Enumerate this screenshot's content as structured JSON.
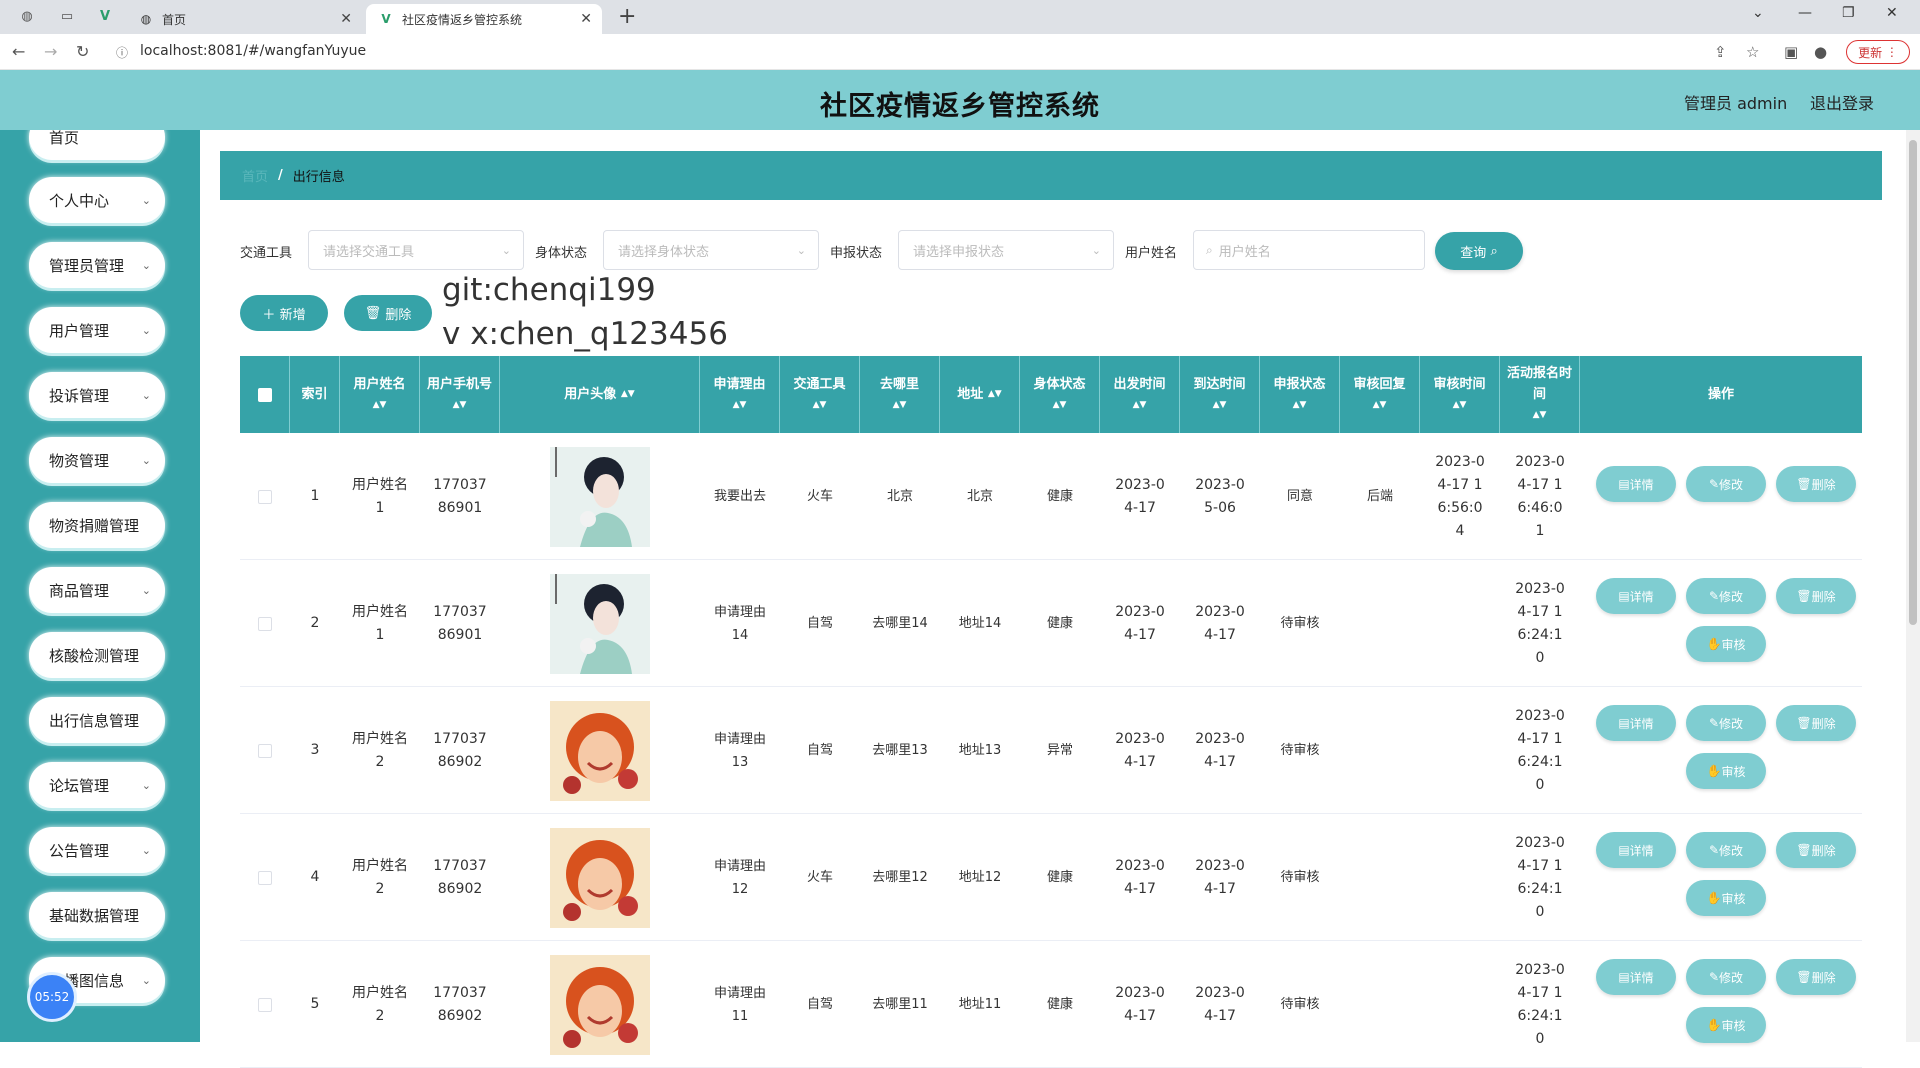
{
  "browser": {
    "tabs": [
      {
        "label": "首页",
        "active": false
      },
      {
        "label": "社区疫情返乡管控系统",
        "active": true
      }
    ],
    "url": "localhost:8081/#/wangfanYuyue",
    "update_label": "更新"
  },
  "header": {
    "title": "社区疫情返乡管控系统",
    "admin_label": "管理员 admin",
    "logout_label": "退出登录"
  },
  "sidebar": {
    "items": [
      {
        "label": "首页",
        "has_chevron": false
      },
      {
        "label": "个人中心",
        "has_chevron": true
      },
      {
        "label": "管理员管理",
        "has_chevron": true
      },
      {
        "label": "用户管理",
        "has_chevron": true
      },
      {
        "label": "投诉管理",
        "has_chevron": true
      },
      {
        "label": "物资管理",
        "has_chevron": true
      },
      {
        "label": "物资捐赠管理",
        "has_chevron": false
      },
      {
        "label": "商品管理",
        "has_chevron": true
      },
      {
        "label": "核酸检测管理",
        "has_chevron": false
      },
      {
        "label": "出行信息管理",
        "has_chevron": false
      },
      {
        "label": "论坛管理",
        "has_chevron": true
      },
      {
        "label": "公告管理",
        "has_chevron": true
      },
      {
        "label": "基础数据管理",
        "has_chevron": false
      },
      {
        "label": "轮播图信息",
        "has_chevron": true
      }
    ],
    "clock": "05:52"
  },
  "breadcrumb": {
    "home": "首页",
    "separator": "/",
    "current": "出行信息"
  },
  "filters": {
    "transport_label": "交通工具",
    "transport_placeholder": "请选择交通工具",
    "health_label": "身体状态",
    "health_placeholder": "请选择身体状态",
    "report_label": "申报状态",
    "report_placeholder": "请选择申报状态",
    "username_label": "用户姓名",
    "username_placeholder": "用户姓名",
    "query_label": "查询"
  },
  "toolbar": {
    "add_label": "新增",
    "delete_label": "删除"
  },
  "overlay": {
    "line1": "git:chenqi199",
    "line2": "v x:chen_q123456"
  },
  "table": {
    "headers": {
      "index": "索引",
      "username": "用户姓名",
      "phone": "用户手机号",
      "avatar": "用户头像",
      "reason": "申请理由",
      "transport": "交通工具",
      "destination": "去哪里",
      "address": "地址",
      "health": "身体状态",
      "depart": "出发时间",
      "arrive": "到达时间",
      "report_status": "申报状态",
      "review_reply": "审核回复",
      "review_time": "审核时间",
      "signup_time": "活动报名时间",
      "actions": "操作"
    },
    "rows": [
      {
        "index": "1",
        "username": "用户姓名1",
        "phone": "17703786901",
        "avatar": "woman-flower",
        "reason": "我要出去",
        "transport": "火车",
        "destination": "北京",
        "address": "北京",
        "health": "健康",
        "depart": "2023-04-17",
        "arrive": "2023-05-06",
        "report_status": "同意",
        "review_reply": "后端",
        "review_time": "2023-04-17 16:56:04",
        "signup_time": "2023-04-17 16:46:01",
        "show_review": false
      },
      {
        "index": "2",
        "username": "用户姓名1",
        "phone": "17703786901",
        "avatar": "woman-flower",
        "reason": "申请理由14",
        "transport": "自驾",
        "destination": "去哪里14",
        "address": "地址14",
        "health": "健康",
        "depart": "2023-04-17",
        "arrive": "2023-04-17",
        "report_status": "待审核",
        "review_reply": "",
        "review_time": "",
        "signup_time": "2023-04-17 16:24:10",
        "show_review": true
      },
      {
        "index": "3",
        "username": "用户姓名2",
        "phone": "17703786902",
        "avatar": "smiling-woman",
        "reason": "申请理由13",
        "transport": "自驾",
        "destination": "去哪里13",
        "address": "地址13",
        "health": "异常",
        "depart": "2023-04-17",
        "arrive": "2023-04-17",
        "report_status": "待审核",
        "review_reply": "",
        "review_time": "",
        "signup_time": "2023-04-17 16:24:10",
        "show_review": true
      },
      {
        "index": "4",
        "username": "用户姓名2",
        "phone": "17703786902",
        "avatar": "smiling-woman",
        "reason": "申请理由12",
        "transport": "火车",
        "destination": "去哪里12",
        "address": "地址12",
        "health": "健康",
        "depart": "2023-04-17",
        "arrive": "2023-04-17",
        "report_status": "待审核",
        "review_reply": "",
        "review_time": "",
        "signup_time": "2023-04-17 16:24:10",
        "show_review": true
      },
      {
        "index": "5",
        "username": "用户姓名2",
        "phone": "17703786902",
        "avatar": "smiling-woman",
        "reason": "申请理由11",
        "transport": "自驾",
        "destination": "去哪里11",
        "address": "地址11",
        "health": "健康",
        "depart": "2023-04-17",
        "arrive": "2023-04-17",
        "report_status": "待审核",
        "review_reply": "",
        "review_time": "",
        "signup_time": "2023-04-17 16:24:10",
        "show_review": true
      }
    ],
    "action_labels": {
      "detail": "详情",
      "edit": "修改",
      "delete": "删除",
      "review": "审核"
    }
  },
  "colors": {
    "primary": "#36a3a8",
    "header_bg": "#7fcdd1",
    "action_btn": "#7fcdd1"
  }
}
